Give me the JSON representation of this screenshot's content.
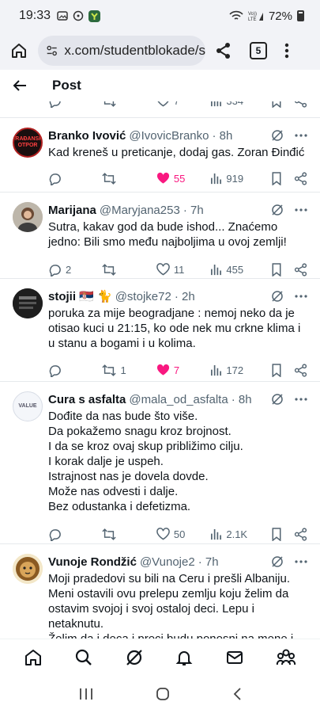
{
  "status": {
    "time": "19:33",
    "battery": "72%"
  },
  "browser": {
    "url": "x.com/studentblokade/s",
    "tab_count": "5"
  },
  "header": {
    "title": "Post"
  },
  "partial": {
    "likes": "7",
    "views": "334"
  },
  "posts": [
    {
      "name": "Branko Ivović",
      "handle": "@IvovicBranko",
      "time": "· 8h",
      "avatar_text": "GRAĐANSKI OTPOR",
      "text": "Kad kreneš u preticanje, dodaj gas. Zoran Đinđić",
      "replies": "",
      "reposts": "",
      "likes": "55",
      "views": "919",
      "liked": true
    },
    {
      "name": "Marijana",
      "handle": "@Maryjana253",
      "time": "· 7h",
      "text": "Sutra,  kakav god da bude ishod... Znaćemo jedno: Bili smo među najboljima u ovoj zemlji!",
      "replies": "2",
      "reposts": "",
      "likes": "11",
      "views": "455",
      "liked": false
    },
    {
      "name": "stojii 🇷🇸 🐈",
      "handle": "@stojke72",
      "time": "· 2h",
      "text": "poruka za mije beogradjane : nemoj neko da je otisao kuci u 21:15, ko ode nek mu crkne klima i u stanu a bogami i u kolima.",
      "replies": "",
      "reposts": "1",
      "likes": "7",
      "views": "172",
      "liked": true
    },
    {
      "name": "Cura s asfalta",
      "handle": "@mala_od_asfalta",
      "time": "· 8h",
      "avatar_text": "VALUE",
      "lines": [
        "Dođite da nas bude što više.",
        "Da pokažemo snagu kroz brojnost.",
        "I da se kroz ovaj skup približimo cilju.",
        "I korak dalje je uspeh.",
        "Istrajnost nas je dovela dovde.",
        "Može nas odvesti i dalje.",
        "Bez odustanka i defetizma."
      ],
      "replies": "",
      "reposts": "",
      "likes": "50",
      "views": "2.1K",
      "liked": false
    },
    {
      "name": "Vunoje Rondžić",
      "handle": "@Vunoje2",
      "time": "· 7h",
      "lines": [
        "Moji pradedovi su bili na Ceru i prešli Albaniju. Meni ostavili ovu prelepu zemlju koju želim da ostavim svojoj i svoj ostaloj deci. Lepu i netaknutu.",
        "Želim da i deca i preci budu ponosni na mene i sve nas!!!"
      ]
    }
  ],
  "colors": {
    "like": "#f91880",
    "muted": "#536471",
    "chrome": "#f2f3f7"
  }
}
